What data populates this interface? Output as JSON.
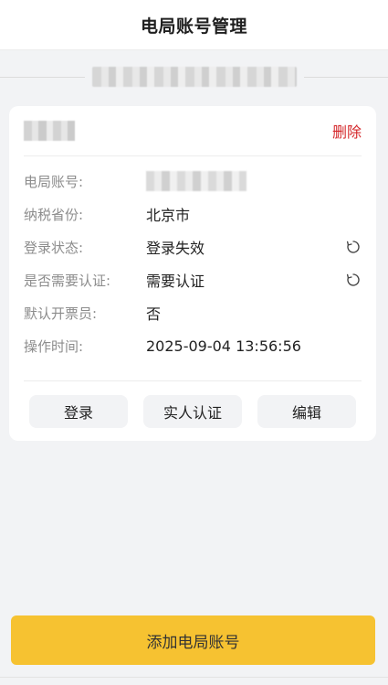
{
  "header": {
    "title": "电局账号管理"
  },
  "account": {
    "delete_label": "删除",
    "fields": [
      {
        "label": "电局账号:"
      },
      {
        "label": "纳税省份:",
        "value": "北京市"
      },
      {
        "label": "登录状态:",
        "value": "登录失效"
      },
      {
        "label": "是否需要认证:",
        "value": "需要认证"
      },
      {
        "label": "默认开票员:",
        "value": "否"
      },
      {
        "label": "操作时间:",
        "value": "2025-09-04 13:56:56"
      }
    ],
    "actions": {
      "login": "登录",
      "verify": "实人认证",
      "edit": "编辑"
    }
  },
  "footer": {
    "add_label": "添加电局账号"
  },
  "colors": {
    "accent": "#f6c231",
    "danger": "#d4272a"
  },
  "icons": {
    "refresh": "refresh-icon"
  }
}
